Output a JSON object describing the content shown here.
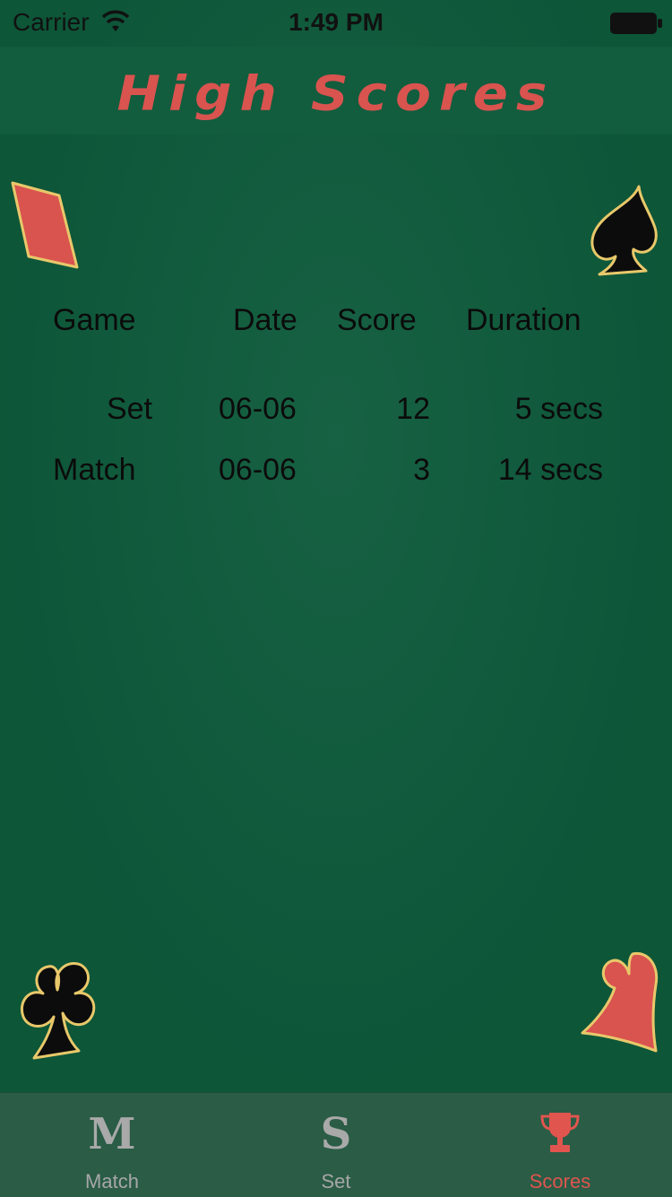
{
  "status_bar": {
    "carrier": "Carrier",
    "time": "1:49 PM",
    "wifi_icon": "wifi-icon",
    "battery_icon": "battery-icon"
  },
  "header": {
    "title": "High Scores",
    "title_color": "#d9534f"
  },
  "decorations": {
    "top_left": "diamond-icon",
    "top_right": "spade-icon",
    "bottom_left": "club-icon",
    "bottom_right": "heart-icon"
  },
  "scores": {
    "columns": [
      "Game",
      "Date",
      "Score",
      "Duration"
    ],
    "rows": [
      {
        "game": "Set",
        "date": "06-06",
        "score": "12",
        "duration": "5 secs"
      },
      {
        "game": "Match",
        "date": "06-06",
        "score": "3",
        "duration": "14 secs"
      }
    ]
  },
  "tab_bar": {
    "tabs": [
      {
        "label": "Match",
        "icon": "M",
        "selected": false
      },
      {
        "label": "Set",
        "icon": "S",
        "selected": false
      },
      {
        "label": "Scores",
        "icon": "trophy-icon",
        "selected": true
      }
    ],
    "active_color": "#e0554e",
    "inactive_color": "#a7a7a7"
  }
}
